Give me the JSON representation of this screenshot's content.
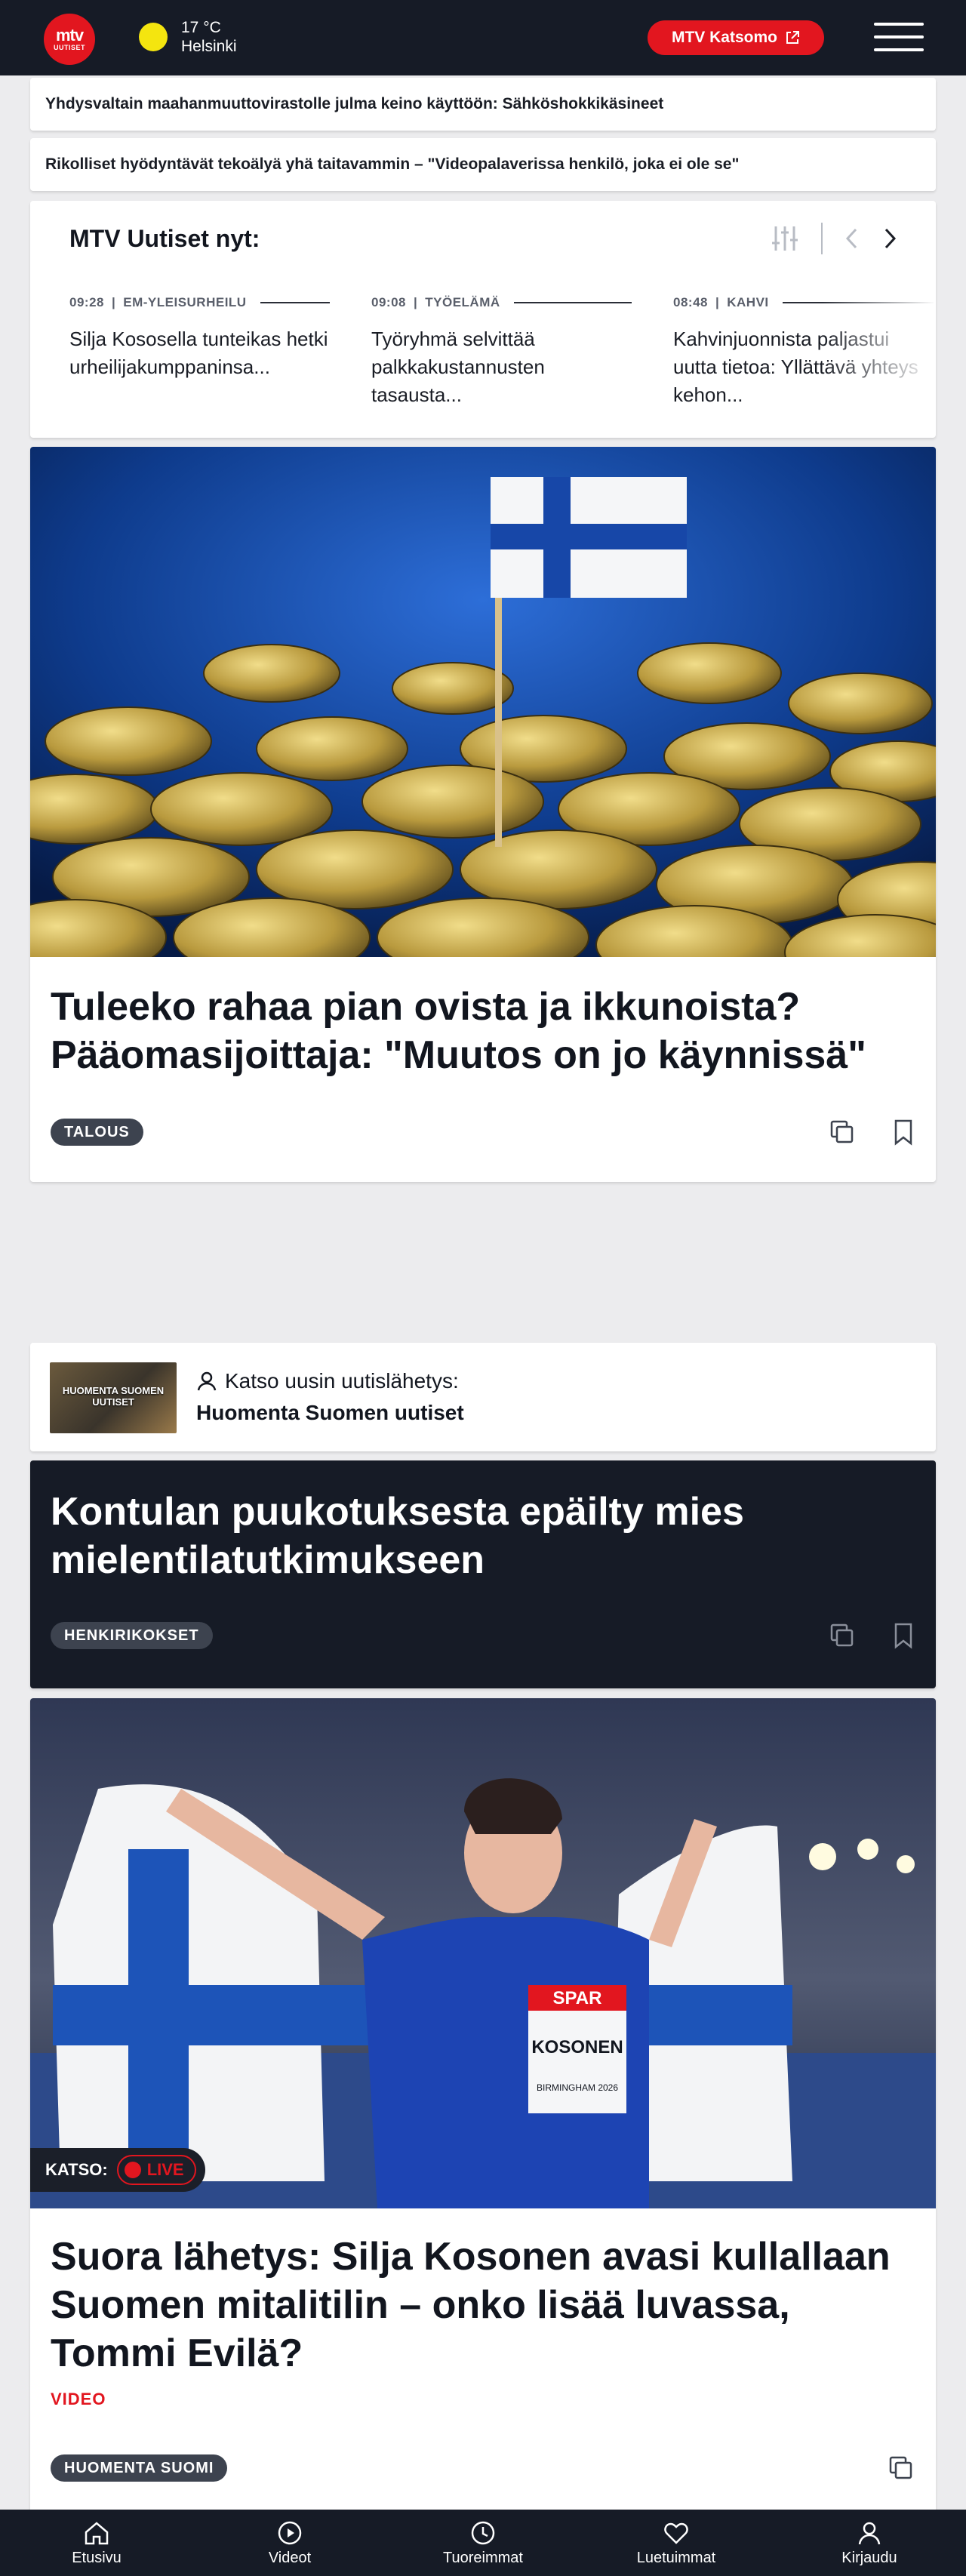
{
  "header": {
    "logo_main": "mtv",
    "logo_sub": "UUTISET",
    "temperature": "17 °C",
    "city": "Helsinki",
    "katsomo_label": "MTV Katsomo",
    "icons": [
      "sun-icon",
      "external-link-icon",
      "hamburger-menu-icon"
    ],
    "colors": {
      "bar": "#161b26",
      "accent": "#e2161f",
      "sun": "#f4e50f"
    }
  },
  "headlines": [
    "Yhdysvaltain maahanmuuttovirastolle julma keino käyttöön: Sähköshokkikäsineet",
    "Rikolliset hyödyntävät tekoälyä yhä taitavammin – \"Videopalaverissa henkilö, joka ei ole se\""
  ],
  "news_now": {
    "title": "MTV Uutiset nyt:",
    "items": [
      {
        "time": "09:28",
        "category": "EM-YLEISURHEILU",
        "text": "Silja Kososella tunteikas hetki urheilijakumppaninsa..."
      },
      {
        "time": "09:08",
        "category": "TYÖELÄMÄ",
        "text": "Työryhmä selvittää palkkakustannusten tasausta..."
      },
      {
        "time": "08:48",
        "category": "KAHVI",
        "text": "Kahvinjuonnista paljastui uutta tietoa: Yllättävä yhteys kehon..."
      }
    ]
  },
  "hero_article": {
    "title": "Tuleeko rahaa pian ovista ja ikkunoista? Pääomasijoittaja: \"Muutos on jo käynnissä\"",
    "tag": "TALOUS"
  },
  "broadcast": {
    "thumb_text": "HUOMENTA SUOMEN UUTISET",
    "label": "Katso uusin uutislähetys:",
    "show": "Huomenta Suomen uutiset"
  },
  "dark_article": {
    "title": "Kontulan puukotuksesta epäilty mies mielentilatutkimukseen",
    "tag": "HENKIRIKOKSET"
  },
  "athlete_article": {
    "watch_label": "KATSO:",
    "live_label": "LIVE",
    "bib_brand": "SPAR",
    "bib_name": "KOSONEN",
    "bib_city": "BIRMINGHAM 2026",
    "title": "Suora lähetys: Silja Kosonen avasi kullallaan Suomen mitalitilin – onko lisää luvassa, Tommi Evilä?",
    "media_label": "VIDEO",
    "tag": "HUOMENTA SUOMI"
  },
  "bottom_nav": [
    {
      "label": "Etusivu",
      "icon": "home-icon"
    },
    {
      "label": "Videot",
      "icon": "play-circle-icon"
    },
    {
      "label": "Tuoreimmat",
      "icon": "clock-icon"
    },
    {
      "label": "Luetuimmat",
      "icon": "heart-icon"
    },
    {
      "label": "Kirjaudu",
      "icon": "user-icon"
    }
  ]
}
